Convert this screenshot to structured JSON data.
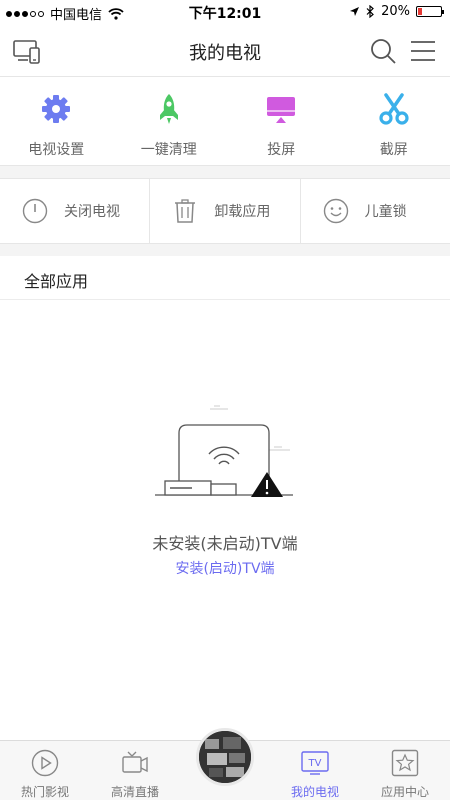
{
  "status_bar": {
    "carrier": "中国电信",
    "time": "下午12:01",
    "battery": "20%",
    "battery_level": 0.2
  },
  "header": {
    "title": "我的电视"
  },
  "quick_actions": [
    {
      "label": "电视设置",
      "icon": "gear-icon",
      "color": "#6d7cf0"
    },
    {
      "label": "一键清理",
      "icon": "rocket-icon",
      "color": "#4cc864"
    },
    {
      "label": "投屏",
      "icon": "screen-cast-icon",
      "color": "#d05adf"
    },
    {
      "label": "截屏",
      "icon": "scissors-icon",
      "color": "#3ab0ea"
    }
  ],
  "tools": [
    {
      "label": "关闭电视",
      "icon": "power-icon"
    },
    {
      "label": "卸载应用",
      "icon": "trash-icon"
    },
    {
      "label": "儿童锁",
      "icon": "smiley-icon"
    }
  ],
  "section": {
    "title": "全部应用"
  },
  "empty_state": {
    "title": "未安装(未启动)TV端",
    "link": "安装(启动)TV端"
  },
  "tabs": [
    {
      "label": "热门影视",
      "icon": "play-icon"
    },
    {
      "label": "高清直播",
      "icon": "video-camera-icon"
    },
    {
      "label": "我的电视",
      "icon": "tv-icon",
      "active": true
    },
    {
      "label": "应用中心",
      "icon": "star-icon"
    }
  ],
  "colors": {
    "accent": "#6b6bf0",
    "battery_low": "#e53935"
  }
}
